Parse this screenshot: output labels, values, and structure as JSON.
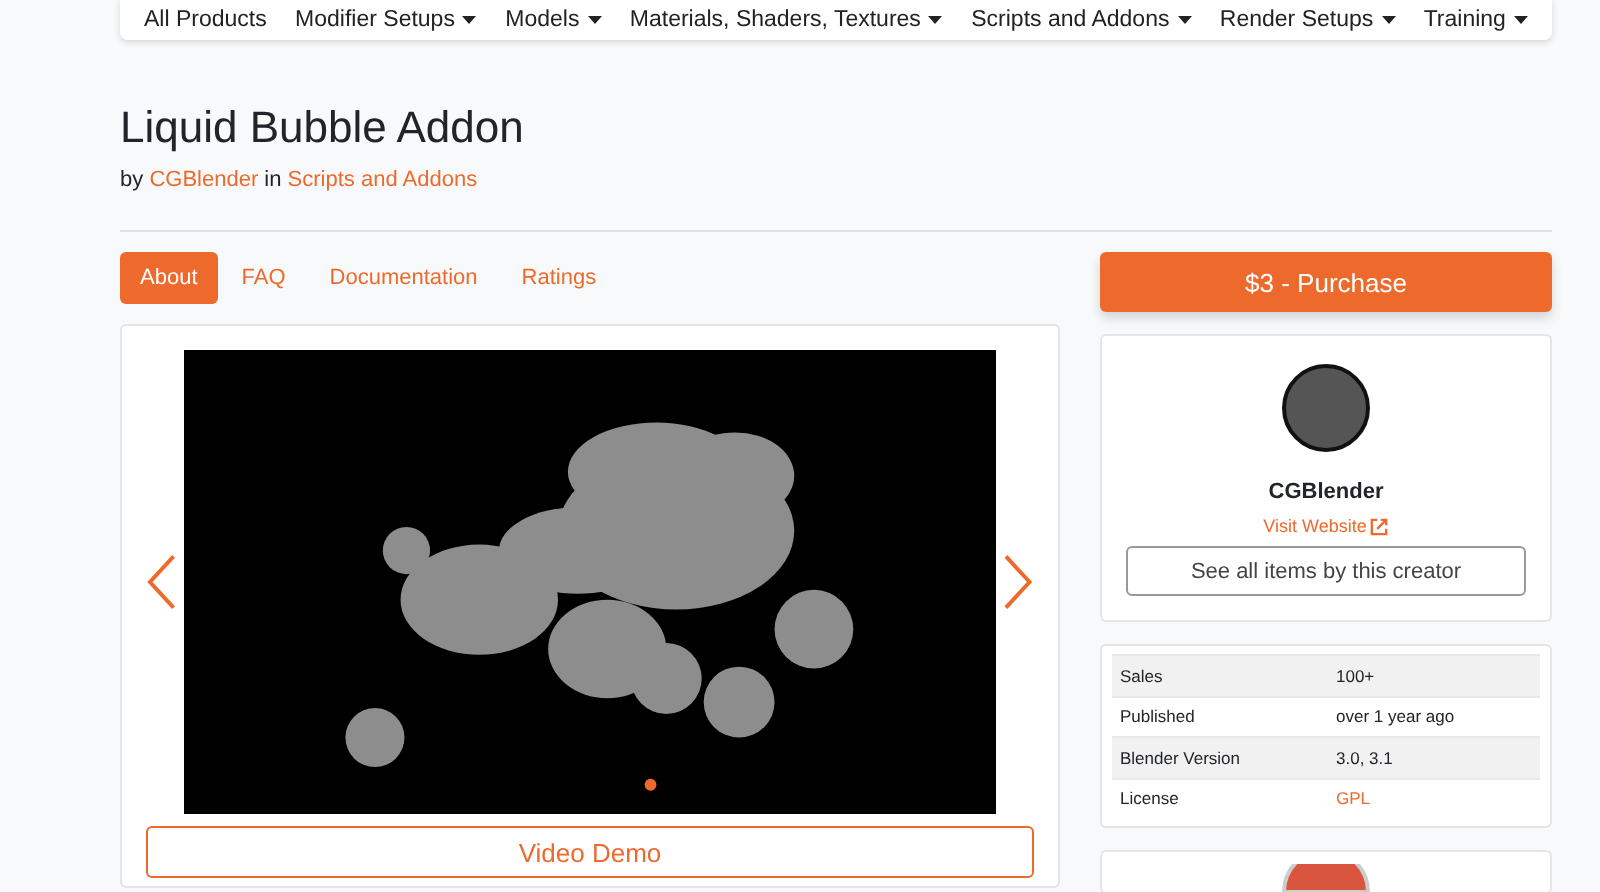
{
  "nav": [
    {
      "label": "All Products",
      "dropdown": false
    },
    {
      "label": "Modifier Setups",
      "dropdown": true
    },
    {
      "label": "Models",
      "dropdown": true
    },
    {
      "label": "Materials, Shaders, Textures",
      "dropdown": true
    },
    {
      "label": "Scripts and Addons",
      "dropdown": true
    },
    {
      "label": "Render Setups",
      "dropdown": true
    },
    {
      "label": "Training",
      "dropdown": true
    }
  ],
  "title": "Liquid Bubble Addon",
  "byline": {
    "by": "by",
    "author": "CGBlender",
    "in": "in",
    "category": "Scripts and Addons"
  },
  "tabs": [
    {
      "label": "About",
      "selected": true
    },
    {
      "label": "FAQ",
      "selected": false
    },
    {
      "label": "Documentation",
      "selected": false
    },
    {
      "label": "Ratings",
      "selected": false
    }
  ],
  "carousel": {
    "indicators": [
      {
        "selected": true
      }
    ]
  },
  "video_button": "Video Demo",
  "purchase_button": "$3 - Purchase",
  "creator": {
    "name": "CGBlender",
    "website_link": "Visit Website",
    "all_items_button": "See all items by this creator"
  },
  "details": [
    {
      "label": "Sales",
      "value": "100+",
      "link": false
    },
    {
      "label": "Published",
      "value": "over 1 year ago",
      "link": false
    },
    {
      "label": "Blender Version",
      "value": "3.0, 3.1",
      "link": false
    },
    {
      "label": "License",
      "value": "GPL",
      "link": true
    }
  ]
}
